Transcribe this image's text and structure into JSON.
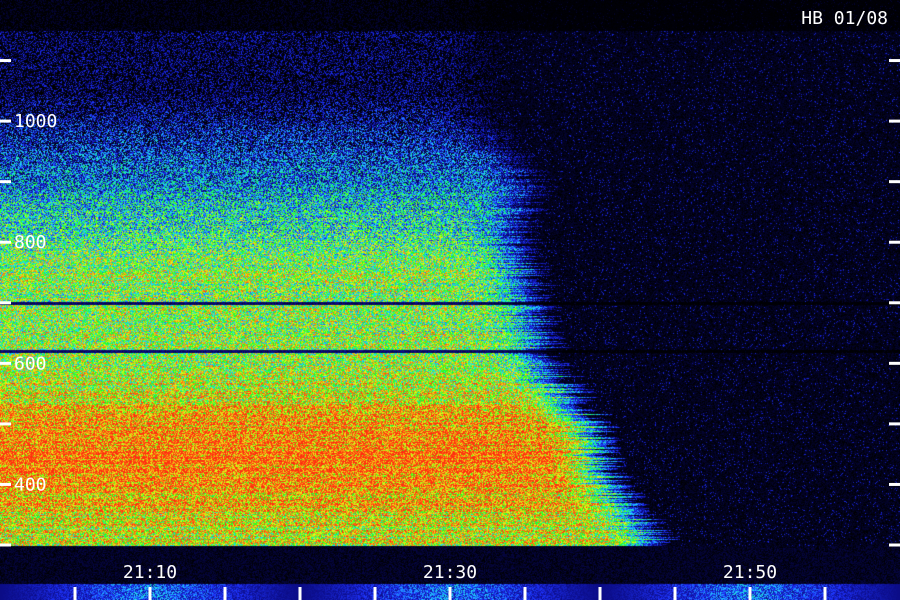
{
  "chart_data": {
    "type": "heatmap",
    "title": "HB 01/08",
    "xlabel": "",
    "ylabel": "",
    "x_tick_labels": [
      {
        "label": "21:10",
        "minutes": 10
      },
      {
        "label": "21:30",
        "minutes": 30
      },
      {
        "label": "21:50",
        "minutes": 50
      }
    ],
    "x_minor_tick_step_minutes": 5,
    "xlim_minutes_after_2100": [
      0,
      60
    ],
    "y_tick_labels": [
      400,
      600,
      800,
      1000
    ],
    "y_minor_tick_step": 100,
    "ylim": [
      300,
      1200
    ],
    "grid": false,
    "colormap": [
      "#000000",
      "#0a0a80",
      "#1f33ff",
      "#21e0ff",
      "#19ff19",
      "#e6ff19",
      "#ff7a10",
      "#ff2a10"
    ],
    "band_edge_minutes": [
      {
        "freq": 320,
        "minutes": 43
      },
      {
        "freq": 400,
        "minutes": 40
      },
      {
        "freq": 500,
        "minutes": 39
      },
      {
        "freq": 600,
        "minutes": 36
      },
      {
        "freq": 700,
        "minutes": 35
      },
      {
        "freq": 800,
        "minutes": 34
      },
      {
        "freq": 900,
        "minutes": 35
      },
      {
        "freq": 1000,
        "minutes": 32
      }
    ],
    "dark_line_freqs": [
      620,
      700
    ]
  },
  "colors": {
    "background": "#000000",
    "text": "#ffffff"
  }
}
